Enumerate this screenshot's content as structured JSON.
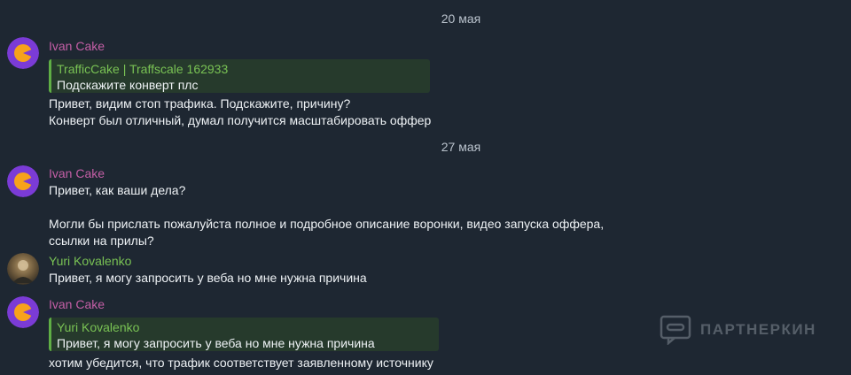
{
  "chat": {
    "date_1": "20 мая",
    "date_2": "27 мая",
    "messages": [
      {
        "author": "Ivan Cake",
        "reply": {
          "author": "TrafficCake | Traffscale 162933",
          "text": "Подскажите конверт плс"
        },
        "lines": [
          "Привет, видим стоп трафика. Подскажите, причину?",
          "Конверт был отличный, думал получится масштабировать оффер"
        ]
      },
      {
        "author": "Ivan Cake",
        "lines": [
          "Привет, как ваши дела?",
          "",
          "Могли бы прислать пожалуйста полное и подробное описание воронки, видео запуска оффера,",
          "ссылки на прилы?"
        ]
      },
      {
        "author": "Yuri Kovalenko",
        "lines": [
          "Привет, я могу запросить у веба но мне нужна причина"
        ]
      },
      {
        "author": "Ivan Cake",
        "reply": {
          "author": "Yuri Kovalenko",
          "text": "Привет, я могу запросить у веба но мне нужна причина"
        },
        "lines": [
          "хотим убедится, что трафик соответствует заявленному источнику"
        ]
      }
    ]
  },
  "watermark": {
    "text": "ПАРТНЕРКИН",
    "icon": "partnerkin-logo-icon"
  },
  "colors": {
    "background": "#1e2732",
    "ivan_name": "#c45fa6",
    "yuri_name": "#79c254",
    "reply_bar": "#5fae45",
    "reply_bg": "#263a2c",
    "avatar_ivan_bg": "#7b3bd6",
    "avatar_ivan_fg": "#f7a21b"
  }
}
